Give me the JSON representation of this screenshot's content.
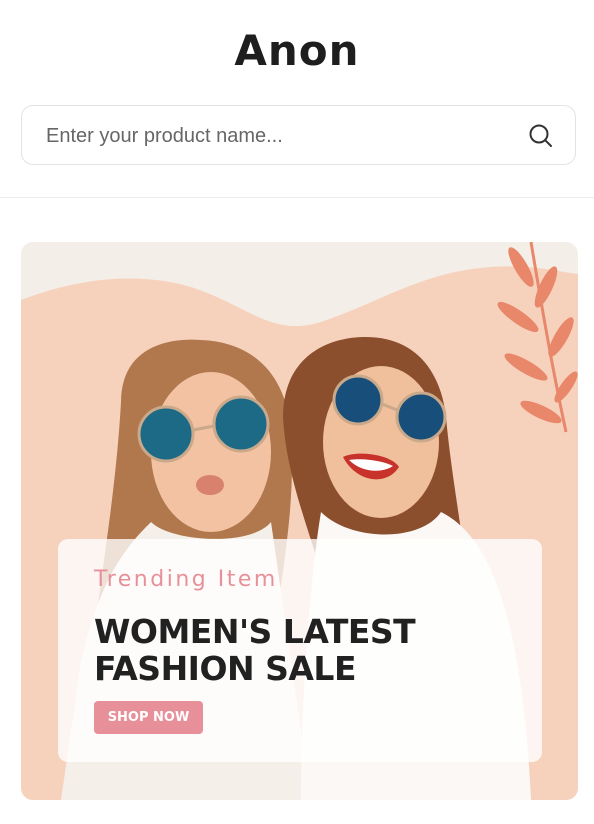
{
  "header": {
    "logo_text": "Anon"
  },
  "search": {
    "placeholder": "Enter your product name..."
  },
  "banner": {
    "subtitle": "Trending Item",
    "title_line1": "WOMEN'S LATEST",
    "title_line2": "FASHION SALE",
    "cta_label": "SHOP NOW"
  },
  "colors": {
    "accent": "#e8909a",
    "banner_bg": "#f3eee7",
    "wave": "#f6d2bd",
    "leaf": "#e9876a"
  },
  "icons": {
    "search": "search-icon",
    "leaf": "leaf-decoration"
  }
}
